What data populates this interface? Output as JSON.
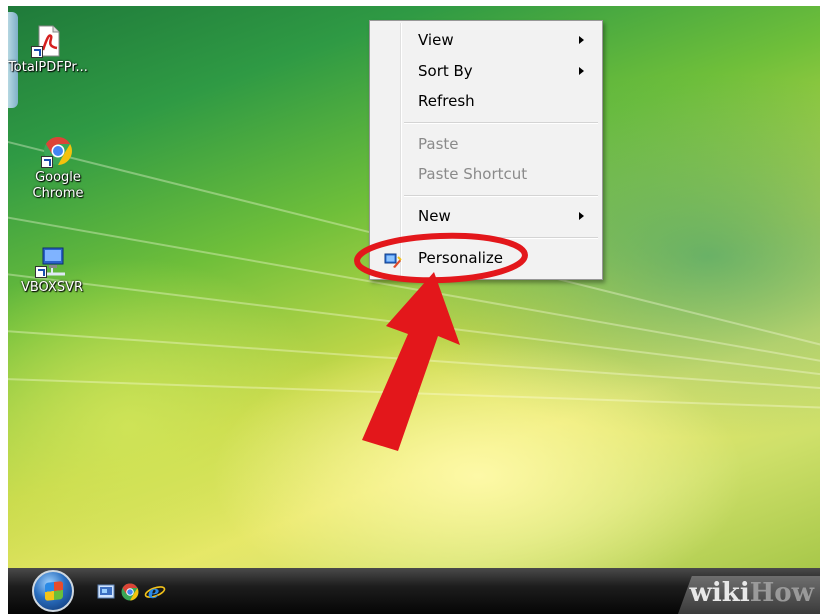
{
  "desktop": {
    "icons": [
      {
        "label": "TotalPDFPr...",
        "icon": "pdf-file-icon"
      },
      {
        "label": "Google Chrome",
        "icon": "chrome-icon"
      },
      {
        "label": "VBOXSVR",
        "icon": "network-share-icon"
      }
    ]
  },
  "context_menu": {
    "items": [
      {
        "label": "View",
        "submenu": true,
        "enabled": true
      },
      {
        "label": "Sort By",
        "submenu": true,
        "enabled": true
      },
      {
        "label": "Refresh",
        "submenu": false,
        "enabled": true
      },
      {
        "label": "Paste",
        "submenu": false,
        "enabled": false
      },
      {
        "label": "Paste Shortcut",
        "submenu": false,
        "enabled": false
      },
      {
        "label": "New",
        "submenu": true,
        "enabled": true
      },
      {
        "label": "Personalize",
        "submenu": false,
        "enabled": true,
        "icon": "personalize-icon"
      }
    ]
  },
  "taskbar": {
    "quick_launch": [
      "show-desktop-icon",
      "chrome-icon",
      "internet-explorer-icon"
    ],
    "watermark_a": "wiki",
    "watermark_b": "How"
  },
  "annotation": {
    "color": "#e3171b"
  }
}
